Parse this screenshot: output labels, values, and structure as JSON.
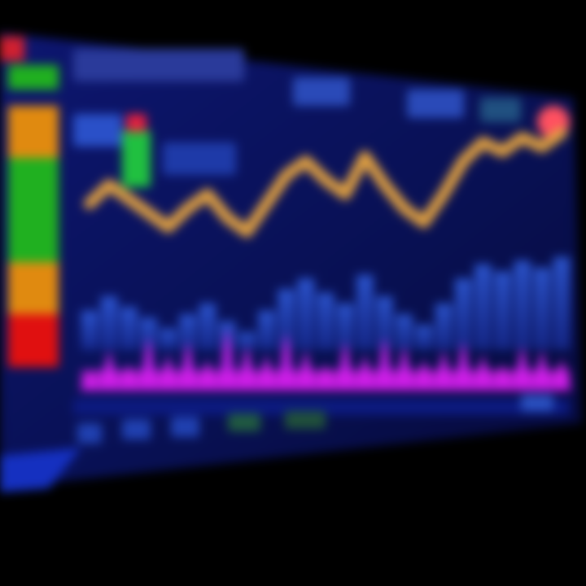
{
  "colors": {
    "background": "#000000",
    "screen_bg": "#0a0f5e",
    "screen_edge": "#1020a8",
    "meter_red": "#e01010",
    "meter_orange": "#e08a10",
    "meter_green": "#20b020",
    "price_line": "#e0a040",
    "volume_magenta": "#e020f0",
    "volume_blue": "#2050e0",
    "header_text_block": "#4a6ad0",
    "close_dot": "#ff5060",
    "candle_green": "#20c040",
    "candle_red": "#e02040"
  },
  "icons": {
    "window_close": "close-dot-icon",
    "window_badge": "app-badge-icon"
  },
  "chart_data": {
    "type": "line",
    "series": [
      {
        "values": [
          62,
          70,
          64,
          58,
          52,
          60,
          66,
          56,
          50,
          62,
          74,
          80,
          72,
          66,
          82,
          70,
          60,
          54,
          66,
          80,
          88,
          84,
          90,
          86,
          92
        ]
      }
    ],
    "volume": {
      "type": "area",
      "values": [
        20,
        45,
        30,
        60,
        40,
        55,
        35,
        70,
        50,
        40,
        65,
        45,
        30,
        55,
        40,
        60,
        50,
        35,
        45,
        55,
        40,
        30,
        50,
        45,
        35
      ]
    },
    "ylim": [
      0,
      100
    ],
    "grid": false
  },
  "meter": {
    "levels": [
      {
        "color_key": "meter_orange"
      },
      {
        "color_key": "meter_green"
      },
      {
        "color_key": "meter_green"
      },
      {
        "color_key": "meter_orange"
      },
      {
        "color_key": "meter_red"
      }
    ]
  }
}
